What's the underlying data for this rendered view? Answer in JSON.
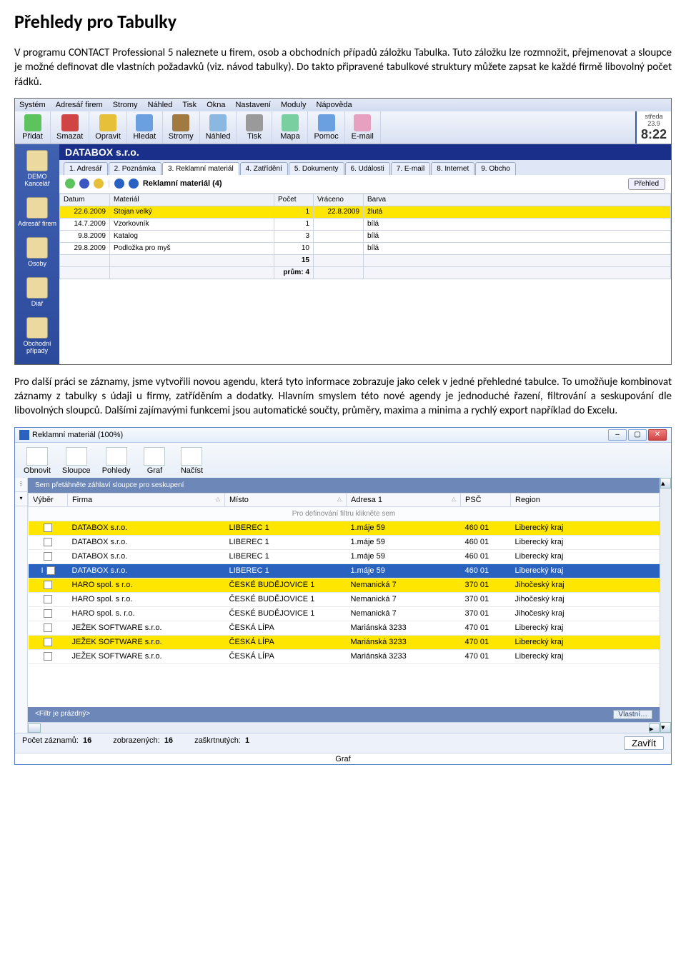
{
  "doc": {
    "title": "Přehledy pro Tabulky",
    "p1": "V programu CONTACT Professional 5 naleznete u firem, osob a obchodních případů záložku Tabulka. Tuto záložku lze rozmnožit, přejmenovat a sloupce je možné definovat dle vlastních požadavků (viz. návod tabulky). Do takto připravené tabulkové struktury můžete zapsat ke každé firmě libovolný počet řádků.",
    "p2": "Pro další práci se záznamy, jsme vytvořili novou agendu, která tyto informace zobrazuje jako celek v jedné přehledné tabulce. To umožňuje kombinovat záznamy z tabulky s údaji u firmy, zatříděním a dodatky. Hlavním smyslem této nové agendy je jednoduché řazení, filtrování a seskupování dle libovolných sloupců. Dalšími zajímavými funkcemi jsou automatické součty, průměry, maxima a minima a rychlý export například do Excelu."
  },
  "shot1": {
    "menu": [
      "Systém",
      "Adresář firem",
      "Stromy",
      "Náhled",
      "Tisk",
      "Okna",
      "Nastavení",
      "Moduly",
      "Nápověda"
    ],
    "toolbar": [
      {
        "label": "Přidat",
        "name": "add-button"
      },
      {
        "label": "Smazat",
        "name": "delete-button"
      },
      {
        "label": "Opravit",
        "name": "edit-button"
      },
      {
        "label": "Hledat",
        "name": "search-button"
      },
      {
        "label": "Stromy",
        "name": "trees-button"
      },
      {
        "label": "Náhled",
        "name": "preview-button"
      },
      {
        "label": "Tisk",
        "name": "print-button"
      },
      {
        "label": "Mapa",
        "name": "map-button"
      },
      {
        "label": "Pomoc",
        "name": "help-button"
      },
      {
        "label": "E-mail",
        "name": "email-button"
      }
    ],
    "clock": {
      "day": "středa",
      "date": "23.9",
      "time": "8:22"
    },
    "sidebar": [
      {
        "label": "DEMO\nKancelář",
        "name": "side-office-button"
      },
      {
        "label": "Adresář firem",
        "name": "side-firms-button"
      },
      {
        "label": "Osoby",
        "name": "side-persons-button"
      },
      {
        "label": "Diář",
        "name": "side-diary-button"
      },
      {
        "label": "Obchodní případy",
        "name": "side-cases-button"
      }
    ],
    "company": "DATABOX s.r.o.",
    "tabs": [
      "1. Adresář",
      "2. Poznámka",
      "3. Reklamní materiál",
      "4. Zatřídění",
      "5. Dokumenty",
      "6. Události",
      "7. E-mail",
      "8. Internet",
      "9. Obcho"
    ],
    "active_tab": 2,
    "list_title": "Reklamní materiál (4)",
    "prehled_btn": "Přehled",
    "cols": [
      "Datum",
      "Materiál",
      "Počet",
      "Vráceno",
      "Barva"
    ],
    "rows": [
      {
        "d": "22.6.2009",
        "m": "Stojan velký",
        "p": "1",
        "v": "22.8.2009",
        "b": "žlutá",
        "y": true
      },
      {
        "d": "14.7.2009",
        "m": "Vzorkovník",
        "p": "1",
        "v": "",
        "b": "bílá",
        "y": false
      },
      {
        "d": "9.8.2009",
        "m": "Katalog",
        "p": "3",
        "v": "",
        "b": "bílá",
        "y": false
      },
      {
        "d": "29.8.2009",
        "m": "Podložka pro myš",
        "p": "10",
        "v": "",
        "b": "bílá",
        "y": false
      }
    ],
    "sum": "15",
    "avg_label": "prům:",
    "avg": "4"
  },
  "shot2": {
    "title": "Reklamní materiál (100%)",
    "toolbar": [
      {
        "label": "Obnovit",
        "name": "refresh-button"
      },
      {
        "label": "Sloupce",
        "name": "columns-button"
      },
      {
        "label": "Pohledy",
        "name": "views-button"
      },
      {
        "label": "Graf",
        "name": "chart-button"
      },
      {
        "label": "Načíst",
        "name": "load-button"
      }
    ],
    "group_hint": "Sem přetáhněte záhlaví sloupce pro seskupení",
    "cols": [
      "Výběr",
      "Firma",
      "Místo",
      "Adresa 1",
      "PSČ",
      "Region"
    ],
    "filter_hint": "Pro definování filtru klikněte sem",
    "rows": [
      {
        "c": false,
        "f": "DATABOX s.r.o.",
        "m": "LIBEREC 1",
        "a": "1.máje 59",
        "p": "460 01",
        "r": "Liberecký kraj",
        "y": true
      },
      {
        "c": false,
        "f": "DATABOX s.r.o.",
        "m": "LIBEREC 1",
        "a": "1.máje 59",
        "p": "460 01",
        "r": "Liberecký kraj",
        "y": false
      },
      {
        "c": false,
        "f": "DATABOX s.r.o.",
        "m": "LIBEREC 1",
        "a": "1.máje 59",
        "p": "460 01",
        "r": "Liberecký kraj",
        "y": false
      },
      {
        "c": true,
        "f": "DATABOX s.r.o.",
        "m": "LIBEREC 1",
        "a": "1.máje 59",
        "p": "460 01",
        "r": "Liberecký kraj",
        "sel": true
      },
      {
        "c": false,
        "f": "HARO spol. s r.o.",
        "m": "ČESKÉ BUDĚJOVICE 1",
        "a": "Nemanická 7",
        "p": "370 01",
        "r": "Jihočeský kraj",
        "y": true
      },
      {
        "c": false,
        "f": "HARO spol. s r.o.",
        "m": "ČESKÉ BUDĚJOVICE 1",
        "a": "Nemanická 7",
        "p": "370 01",
        "r": "Jihočeský kraj",
        "y": false
      },
      {
        "c": false,
        "f": "HARO spol. s. r.o.",
        "m": "ČESKÉ BUDĚJOVICE 1",
        "a": "Nemanická 7",
        "p": "370 01",
        "r": "Jihočeský kraj",
        "y": false
      },
      {
        "c": false,
        "f": "JEŽEK SOFTWARE s.r.o.",
        "m": "ČESKÁ LÍPA",
        "a": "Mariánská 3233",
        "p": "470 01",
        "r": "Liberecký kraj",
        "y": false
      },
      {
        "c": false,
        "f": "JEŽEK SOFTWARE s.r.o.",
        "m": "ČESKÁ LÍPA",
        "a": "Mariánská 3233",
        "p": "470 01",
        "r": "Liberecký kraj",
        "y": true
      },
      {
        "c": false,
        "f": "JEŽEK SOFTWARE s.r.o.",
        "m": "ČESKÁ LÍPA",
        "a": "Mariánská 3233",
        "p": "470 01",
        "r": "Liberecký kraj",
        "y": false
      }
    ],
    "filterbar": "<Filtr je prázdný>",
    "vlastni": "Vlastní…",
    "status": {
      "count_label": "Počet záznamů:",
      "count": "16",
      "shown_label": "zobrazených:",
      "shown": "16",
      "checked_label": "zaškrtnutých:",
      "checked": "1",
      "close": "Zavřít"
    },
    "graf_tab": "Graf"
  }
}
